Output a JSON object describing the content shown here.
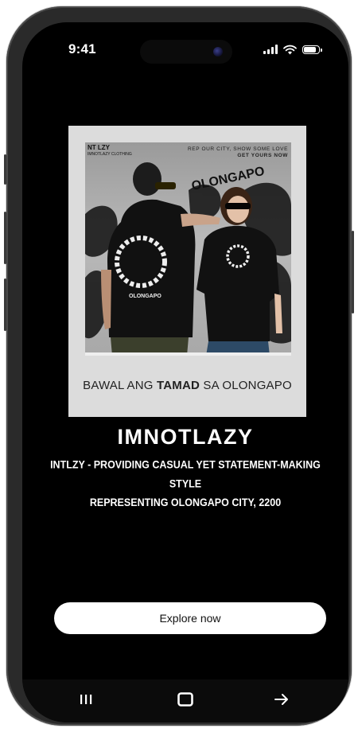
{
  "status_bar": {
    "time": "9:41",
    "icons": [
      "cellular-signal-icon",
      "wifi-icon",
      "battery-icon"
    ],
    "battery_level": 0.85
  },
  "hero": {
    "photo_brand": "NT LZY",
    "photo_brand_sub": "IMNOTLAZY CLOTHING",
    "photo_tagline_1": "REP OUR CITY, SHOW SOME LOVE",
    "photo_tagline_2": "GET YOURS NOW",
    "shirt_print": "OLONGAPO",
    "caption_prefix": "BAWAL ANG ",
    "caption_bold": "TAMAD",
    "caption_suffix": " SA OLONGAPO"
  },
  "brand": {
    "title": "IMNOTLAZY",
    "description_line1": "INTLZY - PROVIDING CASUAL YET STATEMENT-MAKING STYLE",
    "description_line2": "REPRESENTING OLONGAPO CITY, 2200"
  },
  "cta": {
    "label": "Explore now"
  },
  "nav": {
    "items": [
      "recents-icon",
      "home-icon",
      "forward-arrow-icon"
    ]
  },
  "colors": {
    "screen_bg": "#000000",
    "card_bg": "#dcdcdc",
    "cta_bg": "#ffffff",
    "text_light": "#ffffff",
    "text_dark": "#222222"
  }
}
